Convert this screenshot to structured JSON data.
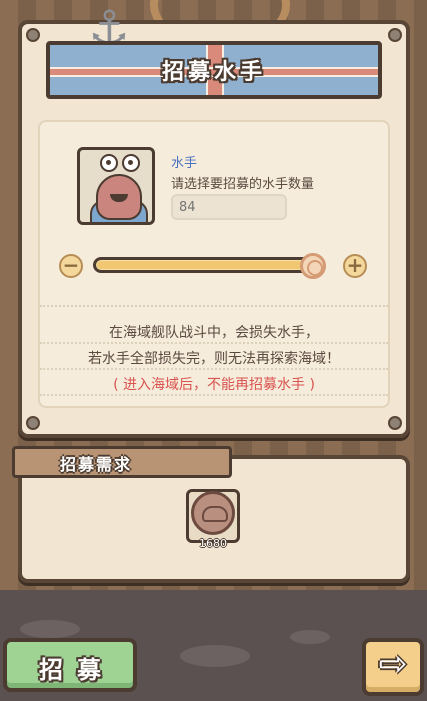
{
  "dialog": {
    "title": "招募水手"
  },
  "sailor": {
    "name": "水手",
    "prompt": "请选择要招募的水手数量",
    "quantity_placeholder": "84",
    "slider_level": 1.0,
    "minus_symbol": "−",
    "plus_symbol": "+"
  },
  "notice": {
    "line1": "在海域舰队战斗中，会损失水手，",
    "line2": "若水手全部损失完，则无法再探索海域！",
    "warning": "( 进入海域后，不能再招募水手 )"
  },
  "requirement": {
    "title": "招募需求",
    "coin_amount": "1680"
  },
  "buttons": {
    "recruit_label": "招募",
    "next_symbol": "⇨"
  },
  "colors": {
    "panel": "#f2e6d2",
    "border": "#4b3b30",
    "accent_blue": "#4a72c0",
    "warning_red": "#d9534f",
    "recruit_green": "#9ed394"
  },
  "icons": [
    "anchor-icon",
    "minus-icon",
    "plus-icon",
    "coin-icon",
    "arrow-right-icon"
  ]
}
